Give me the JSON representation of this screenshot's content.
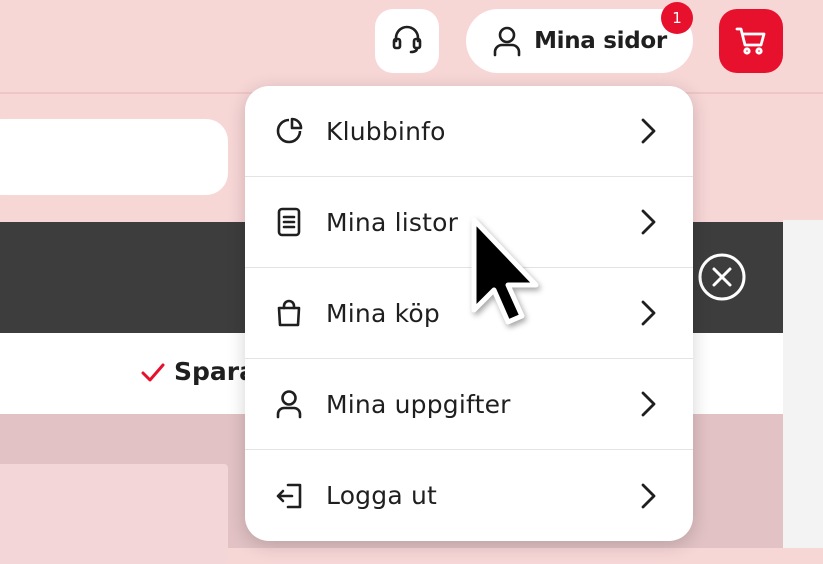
{
  "header": {
    "account_label": "Mina sidor",
    "notification_count": "1",
    "support_icon": "headset-icon",
    "cart_icon": "cart-icon",
    "brand_color": "#e8112d"
  },
  "saved": {
    "label": "Spara"
  },
  "menu": {
    "items": [
      {
        "label": "Klubbinfo",
        "icon": "pie-chart-icon"
      },
      {
        "label": "Mina listor",
        "icon": "list-document-icon"
      },
      {
        "label": "Mina köp",
        "icon": "shopping-bag-icon"
      },
      {
        "label": "Mina uppgifter",
        "icon": "user-icon"
      },
      {
        "label": "Logga ut",
        "icon": "logout-icon"
      }
    ]
  }
}
